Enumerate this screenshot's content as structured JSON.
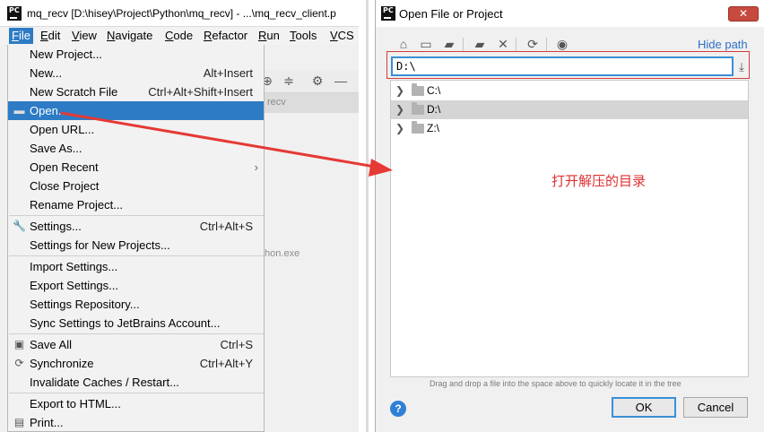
{
  "ide": {
    "title": "mq_recv [D:\\hisey\\Project\\Python\\mq_recv] - ...\\mq_recv_client.p",
    "logo_text": "PC",
    "menubar": [
      "File",
      "Edit",
      "View",
      "Navigate",
      "Code",
      "Refactor",
      "Run",
      "Tools",
      "VCS"
    ],
    "editor_tab_text": "recv",
    "background_text": "thon.exe",
    "file_menu": {
      "new_project": "New Project...",
      "new": "New...",
      "new_shortcut": "Alt+Insert",
      "new_scratch": "New Scratch File",
      "new_scratch_shortcut": "Ctrl+Alt+Shift+Insert",
      "open": "Open...",
      "open_url": "Open URL...",
      "save_as": "Save As...",
      "open_recent": "Open Recent",
      "close_project": "Close Project",
      "rename_project": "Rename Project...",
      "settings": "Settings...",
      "settings_shortcut": "Ctrl+Alt+S",
      "settings_new": "Settings for New Projects...",
      "import_settings": "Import Settings...",
      "export_settings": "Export Settings...",
      "settings_repo": "Settings Repository...",
      "sync_settings": "Sync Settings to JetBrains Account...",
      "save_all": "Save All",
      "save_all_shortcut": "Ctrl+S",
      "synchronize": "Synchronize",
      "synchronize_shortcut": "Ctrl+Alt+Y",
      "invalidate": "Invalidate Caches / Restart...",
      "export_html": "Export to HTML...",
      "print": "Print..."
    }
  },
  "dialog": {
    "logo_text": "PC",
    "title": "Open File or Project",
    "close_label": "✕",
    "hide_path": "Hide path",
    "path_value": "D:\\",
    "tree": [
      {
        "name": "C:\\",
        "selected": false
      },
      {
        "name": "D:\\",
        "selected": true
      },
      {
        "name": "Z:\\",
        "selected": false
      }
    ],
    "annotation": "打开解压的目录",
    "hint": "Drag and drop a file into the space above to quickly locate it in the tree",
    "help_label": "?",
    "ok_label": "OK",
    "cancel_label": "Cancel"
  },
  "colors": {
    "selection": "#2d7bc4",
    "annotation": "#e03030",
    "link": "#2f6fc5"
  }
}
